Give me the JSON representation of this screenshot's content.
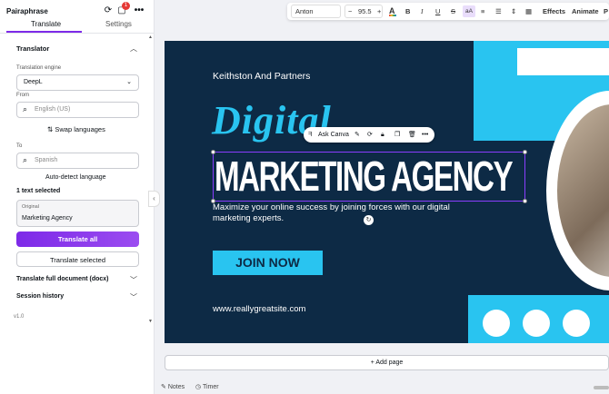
{
  "app": {
    "title": "Pairaphrase",
    "badge": "1",
    "tabs": [
      "Translate",
      "Settings"
    ],
    "version": "v1.0"
  },
  "translator": {
    "section": "Translator",
    "engine_label": "Translation engine",
    "engine_value": "DeepL",
    "from_label": "From",
    "from_placeholder": "English (US)",
    "swap": "Swap languages",
    "to_label": "To",
    "to_placeholder": "Spanish",
    "auto_detect": "Auto-detect language",
    "selected_count": "1 text selected",
    "original_label": "Original",
    "original_value": "Marketing Agency",
    "translate_all": "Translate all",
    "translate_selected": "Translate selected",
    "full_doc": "Translate full document (docx)",
    "history": "Session history"
  },
  "toolbar": {
    "font": "Anton",
    "size": "95.5",
    "minus": "−",
    "plus": "+",
    "effects": "Effects",
    "animate": "Animate",
    "position": "P"
  },
  "floating": {
    "ask": "Ask Canva"
  },
  "design": {
    "company": "Keithston And Partners",
    "script": "Digital",
    "headline": "MARKETING AGENCY",
    "tagline": "Maximize your online success by joining forces with our digital marketing experts.",
    "cta": "JOIN NOW",
    "url": "www.reallygreatsite.com"
  },
  "colors": {
    "accent": "#7d2ae8",
    "canvas_bg": "#0d2a45",
    "cyan": "#29c4f0"
  },
  "footer": {
    "add_page": "+ Add page",
    "notes": "Notes",
    "timer": "Timer"
  }
}
